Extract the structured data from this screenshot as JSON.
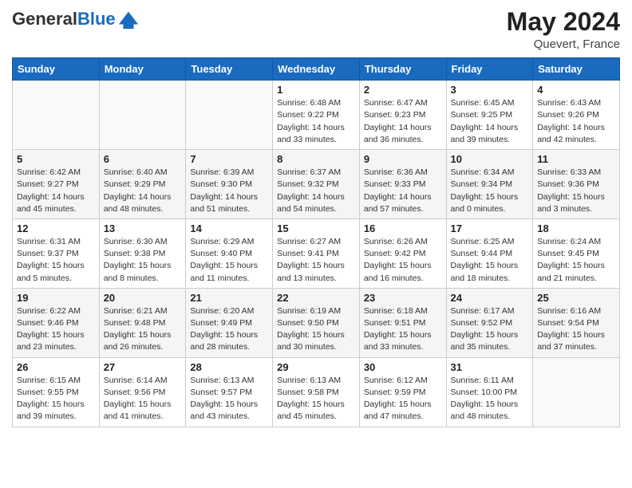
{
  "header": {
    "logo_general": "General",
    "logo_blue": "Blue",
    "month": "May 2024",
    "location": "Quevert, France"
  },
  "weekdays": [
    "Sunday",
    "Monday",
    "Tuesday",
    "Wednesday",
    "Thursday",
    "Friday",
    "Saturday"
  ],
  "weeks": [
    [
      {
        "day": "",
        "info": ""
      },
      {
        "day": "",
        "info": ""
      },
      {
        "day": "",
        "info": ""
      },
      {
        "day": "1",
        "info": "Sunrise: 6:48 AM\nSunset: 9:22 PM\nDaylight: 14 hours\nand 33 minutes."
      },
      {
        "day": "2",
        "info": "Sunrise: 6:47 AM\nSunset: 9:23 PM\nDaylight: 14 hours\nand 36 minutes."
      },
      {
        "day": "3",
        "info": "Sunrise: 6:45 AM\nSunset: 9:25 PM\nDaylight: 14 hours\nand 39 minutes."
      },
      {
        "day": "4",
        "info": "Sunrise: 6:43 AM\nSunset: 9:26 PM\nDaylight: 14 hours\nand 42 minutes."
      }
    ],
    [
      {
        "day": "5",
        "info": "Sunrise: 6:42 AM\nSunset: 9:27 PM\nDaylight: 14 hours\nand 45 minutes."
      },
      {
        "day": "6",
        "info": "Sunrise: 6:40 AM\nSunset: 9:29 PM\nDaylight: 14 hours\nand 48 minutes."
      },
      {
        "day": "7",
        "info": "Sunrise: 6:39 AM\nSunset: 9:30 PM\nDaylight: 14 hours\nand 51 minutes."
      },
      {
        "day": "8",
        "info": "Sunrise: 6:37 AM\nSunset: 9:32 PM\nDaylight: 14 hours\nand 54 minutes."
      },
      {
        "day": "9",
        "info": "Sunrise: 6:36 AM\nSunset: 9:33 PM\nDaylight: 14 hours\nand 57 minutes."
      },
      {
        "day": "10",
        "info": "Sunrise: 6:34 AM\nSunset: 9:34 PM\nDaylight: 15 hours\nand 0 minutes."
      },
      {
        "day": "11",
        "info": "Sunrise: 6:33 AM\nSunset: 9:36 PM\nDaylight: 15 hours\nand 3 minutes."
      }
    ],
    [
      {
        "day": "12",
        "info": "Sunrise: 6:31 AM\nSunset: 9:37 PM\nDaylight: 15 hours\nand 5 minutes."
      },
      {
        "day": "13",
        "info": "Sunrise: 6:30 AM\nSunset: 9:38 PM\nDaylight: 15 hours\nand 8 minutes."
      },
      {
        "day": "14",
        "info": "Sunrise: 6:29 AM\nSunset: 9:40 PM\nDaylight: 15 hours\nand 11 minutes."
      },
      {
        "day": "15",
        "info": "Sunrise: 6:27 AM\nSunset: 9:41 PM\nDaylight: 15 hours\nand 13 minutes."
      },
      {
        "day": "16",
        "info": "Sunrise: 6:26 AM\nSunset: 9:42 PM\nDaylight: 15 hours\nand 16 minutes."
      },
      {
        "day": "17",
        "info": "Sunrise: 6:25 AM\nSunset: 9:44 PM\nDaylight: 15 hours\nand 18 minutes."
      },
      {
        "day": "18",
        "info": "Sunrise: 6:24 AM\nSunset: 9:45 PM\nDaylight: 15 hours\nand 21 minutes."
      }
    ],
    [
      {
        "day": "19",
        "info": "Sunrise: 6:22 AM\nSunset: 9:46 PM\nDaylight: 15 hours\nand 23 minutes."
      },
      {
        "day": "20",
        "info": "Sunrise: 6:21 AM\nSunset: 9:48 PM\nDaylight: 15 hours\nand 26 minutes."
      },
      {
        "day": "21",
        "info": "Sunrise: 6:20 AM\nSunset: 9:49 PM\nDaylight: 15 hours\nand 28 minutes."
      },
      {
        "day": "22",
        "info": "Sunrise: 6:19 AM\nSunset: 9:50 PM\nDaylight: 15 hours\nand 30 minutes."
      },
      {
        "day": "23",
        "info": "Sunrise: 6:18 AM\nSunset: 9:51 PM\nDaylight: 15 hours\nand 33 minutes."
      },
      {
        "day": "24",
        "info": "Sunrise: 6:17 AM\nSunset: 9:52 PM\nDaylight: 15 hours\nand 35 minutes."
      },
      {
        "day": "25",
        "info": "Sunrise: 6:16 AM\nSunset: 9:54 PM\nDaylight: 15 hours\nand 37 minutes."
      }
    ],
    [
      {
        "day": "26",
        "info": "Sunrise: 6:15 AM\nSunset: 9:55 PM\nDaylight: 15 hours\nand 39 minutes."
      },
      {
        "day": "27",
        "info": "Sunrise: 6:14 AM\nSunset: 9:56 PM\nDaylight: 15 hours\nand 41 minutes."
      },
      {
        "day": "28",
        "info": "Sunrise: 6:13 AM\nSunset: 9:57 PM\nDaylight: 15 hours\nand 43 minutes."
      },
      {
        "day": "29",
        "info": "Sunrise: 6:13 AM\nSunset: 9:58 PM\nDaylight: 15 hours\nand 45 minutes."
      },
      {
        "day": "30",
        "info": "Sunrise: 6:12 AM\nSunset: 9:59 PM\nDaylight: 15 hours\nand 47 minutes."
      },
      {
        "day": "31",
        "info": "Sunrise: 6:11 AM\nSunset: 10:00 PM\nDaylight: 15 hours\nand 48 minutes."
      },
      {
        "day": "",
        "info": ""
      }
    ]
  ]
}
